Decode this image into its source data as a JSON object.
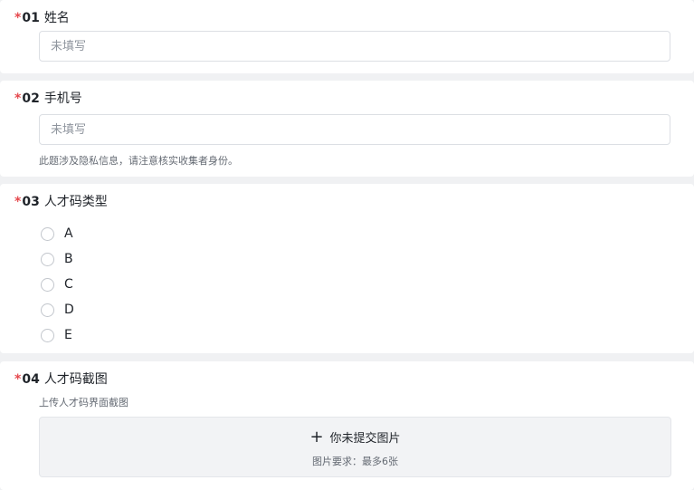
{
  "questions": [
    {
      "required_mark": "*",
      "number": "01",
      "title": "姓名",
      "placeholder": "未填写"
    },
    {
      "required_mark": "*",
      "number": "02",
      "title": "手机号",
      "placeholder": "未填写",
      "hint": "此题涉及隐私信息，请注意核实收集者身份。"
    },
    {
      "required_mark": "*",
      "number": "03",
      "title": "人才码类型",
      "options": [
        "A",
        "B",
        "C",
        "D",
        "E"
      ]
    },
    {
      "required_mark": "*",
      "number": "04",
      "title": "人才码截图",
      "description": "上传人才码界面截图",
      "upload_label": "你未提交图片",
      "upload_requirement": "图片要求：最多6张"
    }
  ],
  "colors": {
    "required": "#e5484d",
    "background": "#f0f1f3",
    "card": "#ffffff",
    "upload_area": "#f2f3f5"
  },
  "icons": {
    "upload": "plus-icon",
    "option": "radio-circle"
  }
}
